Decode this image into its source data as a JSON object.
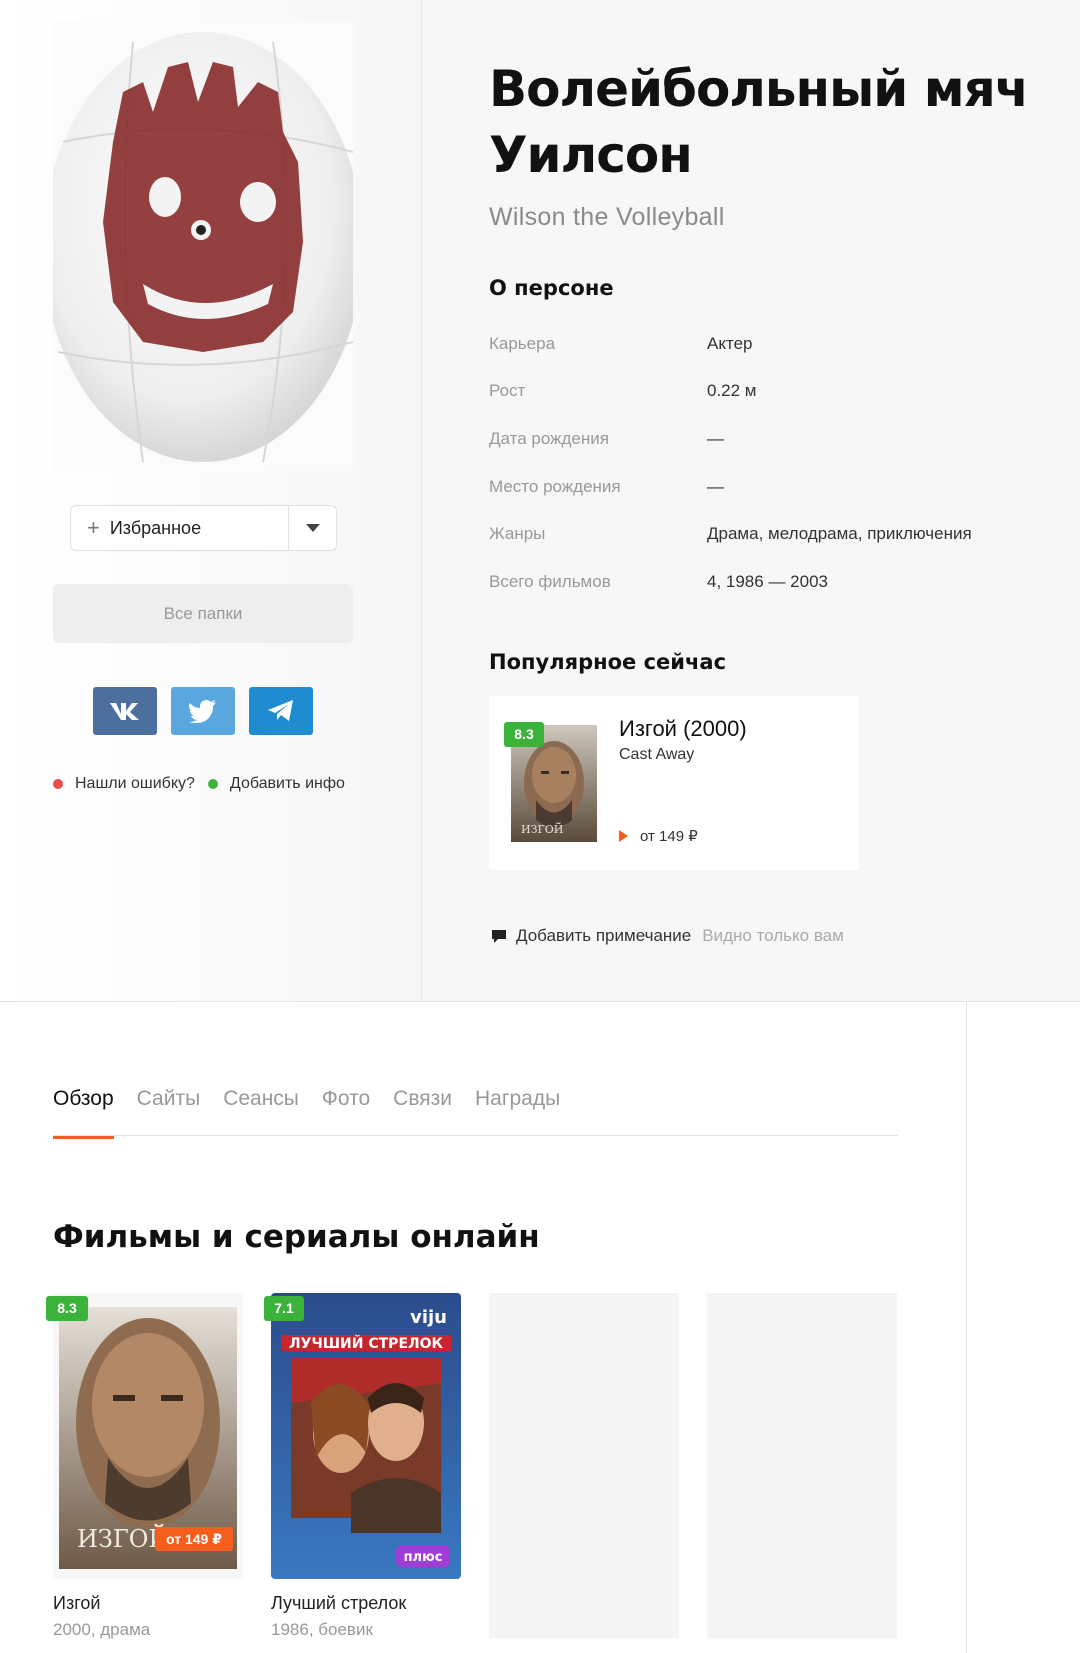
{
  "person": {
    "title": "Волейбольный мяч Уилсон",
    "original_name": "Wilson the Volleyball"
  },
  "left": {
    "favorite_label": "Избранное",
    "all_folders": "Все папки",
    "report_error": "Нашли ошибку?",
    "add_info": "Добавить инфо",
    "share_icons": [
      "vk-icon",
      "twitter-icon",
      "telegram-icon"
    ]
  },
  "about": {
    "heading": "О персоне",
    "rows": [
      {
        "label": "Карьера",
        "value": "Актер"
      },
      {
        "label": "Рост",
        "value": "0.22 м"
      },
      {
        "label": "Дата рождения",
        "value": "—"
      },
      {
        "label": "Место рождения",
        "value": "—"
      },
      {
        "label": "Жанры",
        "value": "Драма, мелодрама, приключения"
      },
      {
        "label": "Всего фильмов",
        "value": "4, 1986 — 2003"
      }
    ]
  },
  "popular": {
    "heading": "Популярное сейчас",
    "rating": "8.3",
    "title": "Изгой (2000)",
    "original": "Cast Away",
    "price": "от 149 ₽",
    "poster_caption": "ИЗГОЙ"
  },
  "note": {
    "label": "Добавить примечание",
    "hint": "Видно только вам"
  },
  "tabs": [
    "Обзор",
    "Сайты",
    "Сеансы",
    "Фото",
    "Связи",
    "Награды"
  ],
  "films_section": {
    "heading": "Фильмы и сериалы онлайн",
    "items": [
      {
        "rating": "8.3",
        "title": "Изгой",
        "meta": "2000, драма",
        "price_badge": "от 149 ₽",
        "poster_caption": "ИЗГОЙ"
      },
      {
        "rating": "7.1",
        "title": "Лучший стрелок",
        "meta": "1986, боевик",
        "poster_banner": "ЛУЧШИЙ СТРЕЛОК",
        "provider": "viju",
        "badge": "плюс"
      }
    ]
  },
  "colors": {
    "accent": "#f45e1c",
    "rating_green": "#3bb33b",
    "vk": "#4d6f9d",
    "twitter": "#5aa7e0",
    "telegram": "#1f8bd0"
  }
}
